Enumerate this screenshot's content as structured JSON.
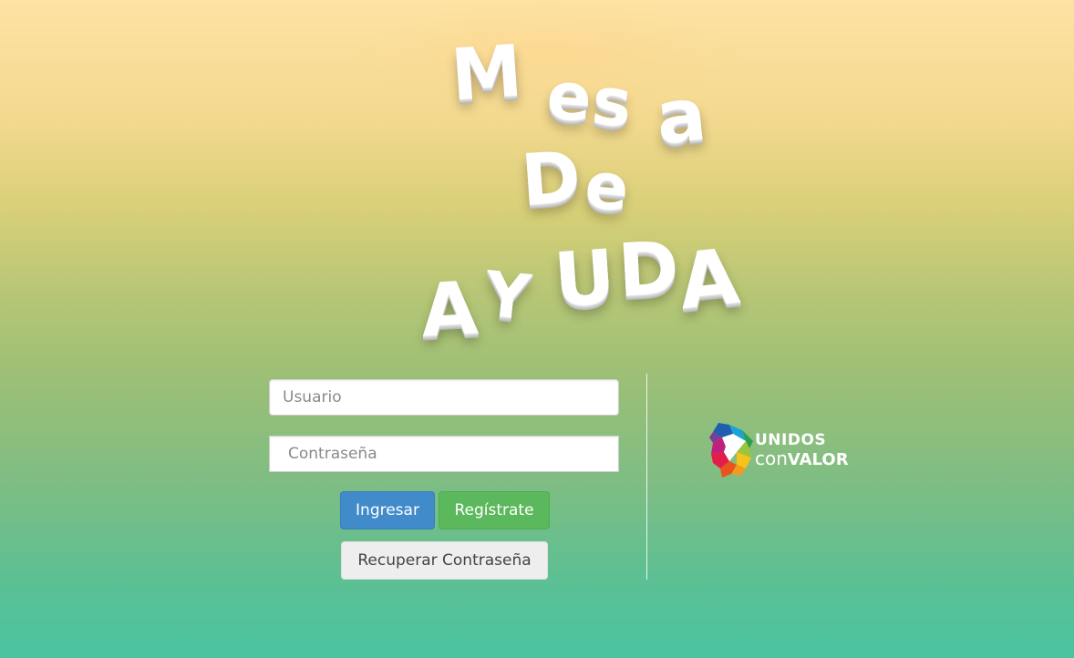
{
  "title": {
    "line1": [
      "M",
      "e",
      "s",
      "a"
    ],
    "line2": [
      "D",
      "e"
    ],
    "line3": [
      "A",
      "Y",
      "U",
      "D",
      "A"
    ]
  },
  "form": {
    "username_placeholder": "Usuario",
    "password_placeholder": "Contraseña",
    "login_label": "Ingresar",
    "register_label": "Regístrate",
    "recover_label": "Recuperar Contraseña"
  },
  "logo": {
    "line1": "UNIDOS",
    "line2_prefix": "con",
    "line2_bold": "VALOR"
  },
  "colors": {
    "login_button": "#428bca",
    "register_button": "#5cb85c",
    "recover_button": "#eeeeee"
  }
}
